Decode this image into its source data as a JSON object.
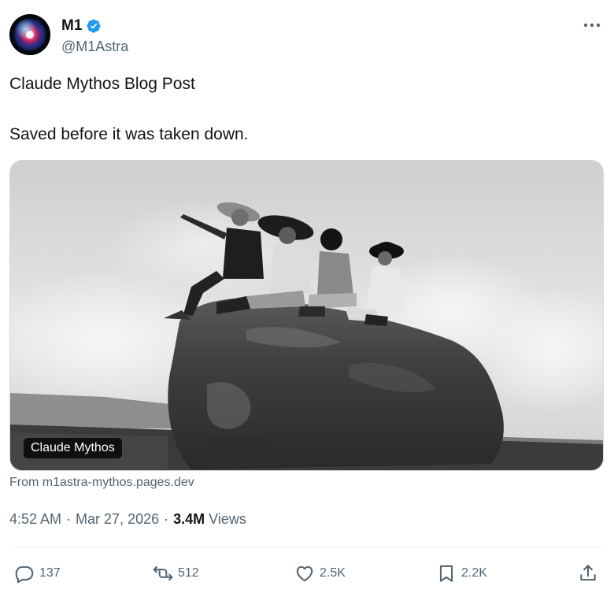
{
  "author": {
    "display_name": "M1",
    "handle": "@M1Astra",
    "verified": true,
    "verified_icon": "verified-badge-icon",
    "verified_color": "#1d9bf0"
  },
  "tweet": {
    "line1": "Claude Mythos Blog Post",
    "line2": "Saved before it was taken down."
  },
  "card": {
    "label": "Claude Mythos",
    "source": "From m1astra-mythos.pages.dev"
  },
  "meta": {
    "time": "4:52 AM",
    "separator": "·",
    "date": "Mar 27, 2026",
    "views_count": "3.4M",
    "views_label": "Views"
  },
  "actions": {
    "replies": "137",
    "retweets": "512",
    "likes": "2.5K",
    "bookmarks": "2.2K"
  },
  "colors": {
    "text": "#0f1419",
    "secondary": "#536471",
    "border": "#cfd9de"
  }
}
